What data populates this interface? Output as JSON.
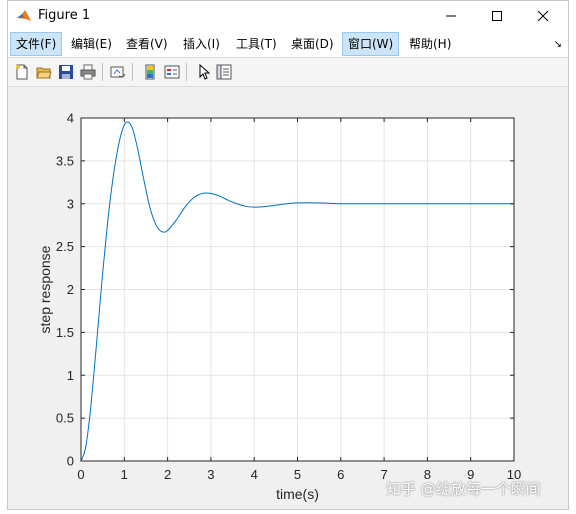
{
  "window": {
    "title": "Figure 1"
  },
  "menubar": {
    "items": [
      "文件(F)",
      "编辑(E)",
      "查看(V)",
      "插入(I)",
      "工具(T)",
      "桌面(D)",
      "窗口(W)",
      "帮助(H)"
    ],
    "more": "↘"
  },
  "toolbar": {
    "icons": [
      "new-figure-icon",
      "open-file-icon",
      "save-icon",
      "print-icon",
      "link-plot-icon",
      "insert-colorbar-icon",
      "insert-legend-icon",
      "pointer-icon",
      "property-inspector-icon"
    ]
  },
  "chart_data": {
    "type": "line",
    "title": "",
    "xlabel": "time(s)",
    "ylabel": "step response",
    "xlim": [
      0,
      10
    ],
    "ylim": [
      0,
      4
    ],
    "xticks": [
      "0",
      "1",
      "2",
      "3",
      "4",
      "5",
      "6",
      "7",
      "8",
      "9",
      "10"
    ],
    "yticks": [
      "0",
      "0.5",
      "1",
      "1.5",
      "2",
      "2.5",
      "3",
      "3.5",
      "4"
    ],
    "grid": true,
    "series": [
      {
        "color": "#0072bd",
        "x": [
          0,
          0.1,
          0.2,
          0.3,
          0.4,
          0.5,
          0.6,
          0.7,
          0.8,
          0.9,
          1.0,
          1.1,
          1.2,
          1.3,
          1.4,
          1.5,
          1.6,
          1.7,
          1.8,
          1.9,
          2.0,
          2.2,
          2.4,
          2.6,
          2.8,
          3.0,
          3.2,
          3.4,
          3.6,
          3.8,
          4.0,
          4.3,
          4.6,
          5.0,
          5.5,
          6.0,
          6.5,
          7.0,
          8.0,
          9.0,
          10.0
        ],
        "y": [
          0,
          0.14,
          0.51,
          1.03,
          1.61,
          2.19,
          2.71,
          3.15,
          3.5,
          3.76,
          3.92,
          3.95,
          3.86,
          3.66,
          3.41,
          3.16,
          2.94,
          2.79,
          2.7,
          2.67,
          2.69,
          2.81,
          2.96,
          3.07,
          3.12,
          3.12,
          3.09,
          3.04,
          3.0,
          2.97,
          2.96,
          2.97,
          2.99,
          3.01,
          3.01,
          3.0,
          3.0,
          3.0,
          3.0,
          3.0,
          3.0
        ]
      }
    ]
  },
  "watermark": "知乎 @绽放每一个瞬间"
}
